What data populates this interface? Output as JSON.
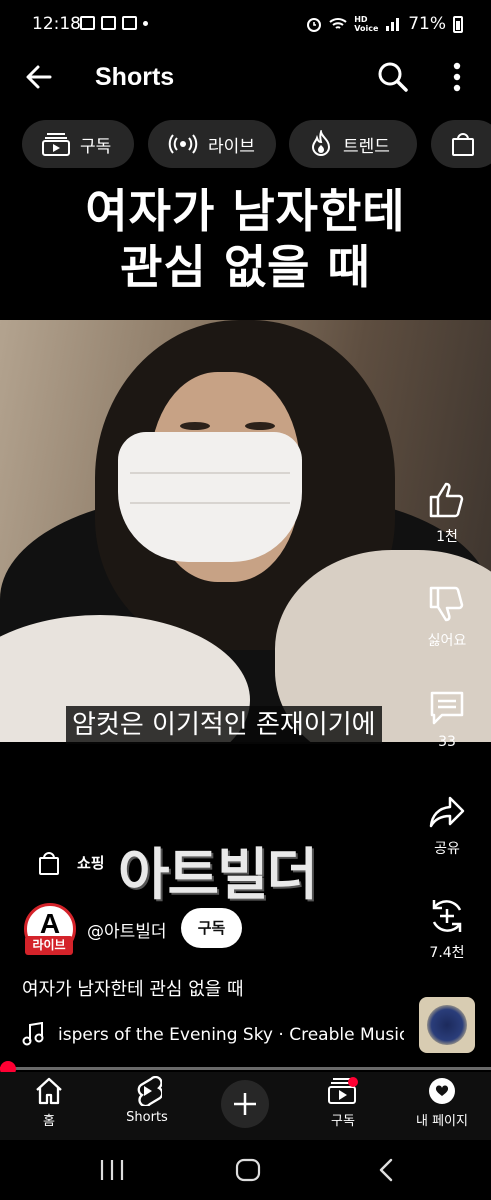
{
  "status_bar": {
    "time": "12:18",
    "battery": "71%",
    "network": "HD Voice"
  },
  "header": {
    "title": "Shorts"
  },
  "chips": [
    {
      "label": "구독",
      "icon": "subscriptions-icon"
    },
    {
      "label": "라이브",
      "icon": "live-icon"
    },
    {
      "label": "트렌드",
      "icon": "trending-icon"
    },
    {
      "label": "",
      "icon": "shopping-bag-icon"
    }
  ],
  "video": {
    "title_line1": "여자가 남자한테",
    "title_line2": "관심 없을 때",
    "subtitle": "암컷은 이기적인 존재이기에",
    "progress_fraction": 0.01
  },
  "actions": {
    "like": "1천",
    "dislike": "싫어요",
    "comments": "33",
    "share": "공유",
    "remix": "7.4천"
  },
  "brand_overlay": {
    "shop_label": "쇼핑",
    "text": "아트빌더"
  },
  "channel": {
    "avatar_letter": "A",
    "avatar_badge": "라이브",
    "name": "@아트빌더",
    "subscribe_label": "구독"
  },
  "description": "여자가 남자한테 관심 없을 때",
  "music": {
    "text": "ispers of the Evening Sky · Creable Music"
  },
  "bottom_nav": {
    "home": "홈",
    "shorts": "Shorts",
    "subscriptions": "구독",
    "you": "내 페이지"
  },
  "colors": {
    "accent": "#ff0033",
    "chip_bg": "#272727",
    "live_badge": "#d4232a"
  }
}
